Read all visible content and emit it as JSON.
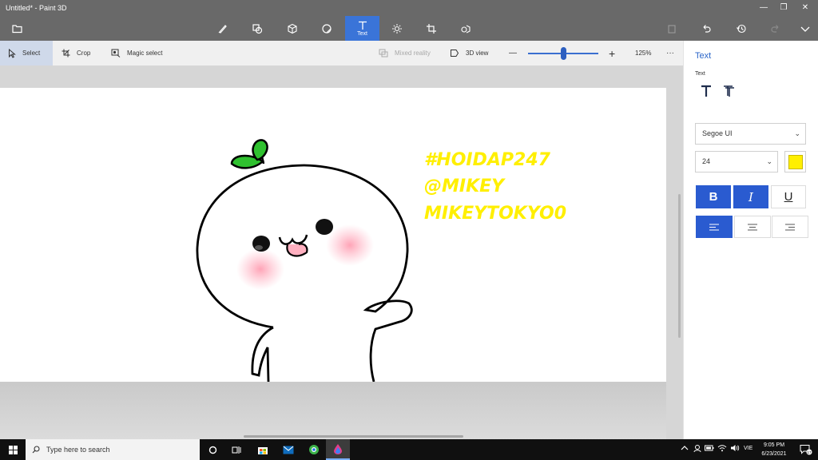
{
  "app": {
    "title": "Untitled* - Paint 3D"
  },
  "window_controls": {
    "minimize": "—",
    "maximize": "❐",
    "close": "✕"
  },
  "ribbon": {
    "tools": [
      {
        "name": "brushes",
        "label": ""
      },
      {
        "name": "2d-shapes",
        "label": ""
      },
      {
        "name": "3d-shapes",
        "label": ""
      },
      {
        "name": "stickers",
        "label": ""
      },
      {
        "name": "text",
        "label": "Text"
      },
      {
        "name": "effects",
        "label": ""
      },
      {
        "name": "canvas",
        "label": ""
      },
      {
        "name": "3d-library",
        "label": ""
      }
    ]
  },
  "toolbar": {
    "select": "Select",
    "crop": "Crop",
    "magic_select": "Magic select",
    "mixed_reality": "Mixed reality",
    "view_3d": "3D view",
    "zoom_minus": "—",
    "zoom_plus": "+",
    "zoom_level": "125%",
    "zoom_fraction": 0.5,
    "more": "···"
  },
  "canvas": {
    "text_lines": [
      "#HOIDAP247",
      "@MIKEY",
      "MIKEYTOKYO0"
    ],
    "text_color": "#ffef00"
  },
  "panel": {
    "title": "Text",
    "subtitle": "Text",
    "font": "Segoe UI",
    "size": "24",
    "color": "#ffef00",
    "bold_label": "B",
    "italic_label": "I",
    "underline_label": "U"
  },
  "taskbar": {
    "search_placeholder": "Type here to search",
    "language": "VIE",
    "time": "9:05 PM",
    "date": "6/23/2021",
    "notification_count": "17"
  },
  "colors": {
    "accent": "#3a74d8",
    "titlebar": "#696969",
    "highlight": "#ffef00"
  }
}
